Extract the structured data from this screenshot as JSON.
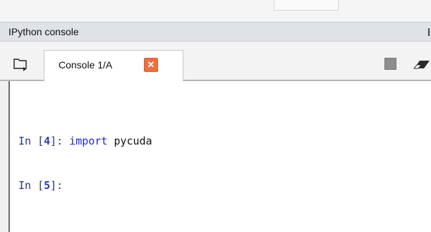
{
  "pane": {
    "title": "IPython console"
  },
  "tabs": [
    {
      "label": "Console 1/A",
      "close_glyph": "✕"
    }
  ],
  "console": {
    "lines": [
      {
        "prompt_in": "In [",
        "prompt_num": "4",
        "prompt_end": "]: ",
        "keyword": "import",
        "code_rest": " pycuda"
      },
      {
        "prompt_in": "In [",
        "prompt_num": "5",
        "prompt_end": "]:"
      }
    ]
  },
  "icons": {
    "new_console": "folder-icon",
    "close_tab": "close-icon",
    "interrupt": "stop-icon",
    "clear": "eraser-icon"
  },
  "colors": {
    "close_button": "#f36d3f",
    "keyword": "#1d27d6",
    "prompt": "#26327a",
    "titlebar": "#dfe3e8"
  }
}
